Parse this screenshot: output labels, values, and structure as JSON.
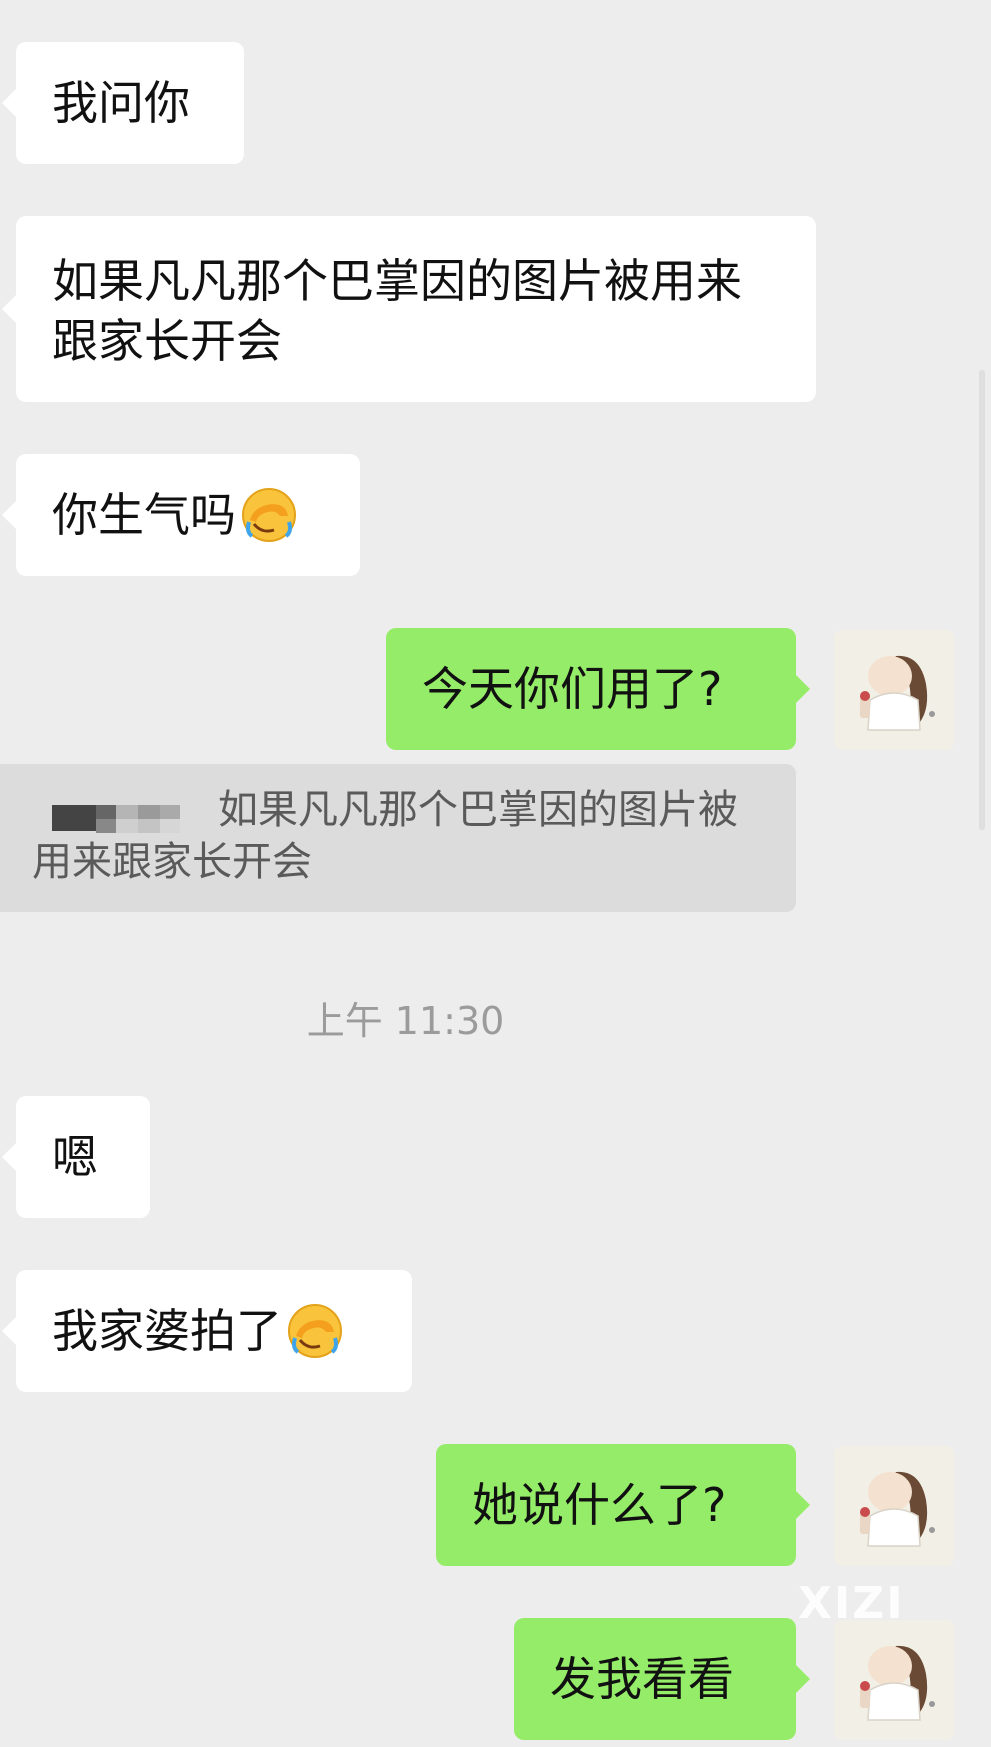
{
  "messages": [
    {
      "side": "in",
      "text": "我问你"
    },
    {
      "side": "in",
      "text": "如果凡凡那个巴掌因的图片被用来跟家长开会"
    },
    {
      "side": "in",
      "text": "你生气吗",
      "emoji": "facepalm-crying"
    },
    {
      "side": "out",
      "text": "今天你们用了?"
    },
    {
      "side": "in",
      "text": "嗯"
    },
    {
      "side": "in",
      "text": "我家婆拍了",
      "emoji": "facepalm-crying"
    },
    {
      "side": "out",
      "text": "她说什么了?"
    },
    {
      "side": "out",
      "text": "发我看看"
    }
  ],
  "quote": {
    "text": "如果凡凡那个巴掌因的图片被用来跟家长开会",
    "sender": "redacted"
  },
  "timestamp": "上午 11:30",
  "watermark": "XIZI",
  "colors": {
    "background": "#ededed",
    "incoming_bubble": "#ffffff",
    "outgoing_bubble": "#95ec69",
    "quote_bg": "#dcdcdc",
    "timestamp": "#9b9b9b"
  }
}
